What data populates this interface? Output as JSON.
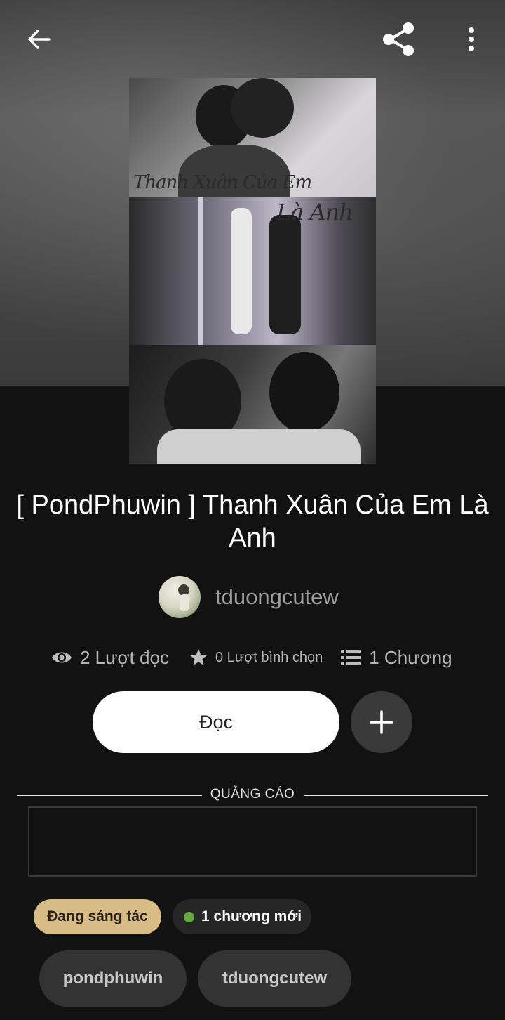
{
  "story": {
    "title": "[ PondPhuwin ] Thanh Xuân Của Em Là Anh",
    "cover_text_1": "Thanh Xuân Của Em",
    "cover_text_2": "Là Anh"
  },
  "author": {
    "name": "tduongcutew"
  },
  "stats": {
    "reads": "2 Lượt đọc",
    "votes": "0 Lượt bình chọn",
    "chapters": "1 Chương"
  },
  "actions": {
    "read_label": "Đọc"
  },
  "ad": {
    "label": "QUẢNG CÁO"
  },
  "badges": {
    "status": "Đang sáng tác",
    "new_chapters": "1 chương mới"
  },
  "tags": [
    "pondphuwin",
    "tduongcutew"
  ],
  "icons": {
    "back": "arrow-left-icon",
    "share": "share-icon",
    "more": "more-vertical-icon",
    "reads": "eye-icon",
    "votes": "star-icon",
    "chapters": "list-icon",
    "add": "plus-icon"
  },
  "colors": {
    "background": "#121212",
    "status_badge": "#d8bc85",
    "new_dot": "#6aa842",
    "tag_bg": "#333333"
  }
}
